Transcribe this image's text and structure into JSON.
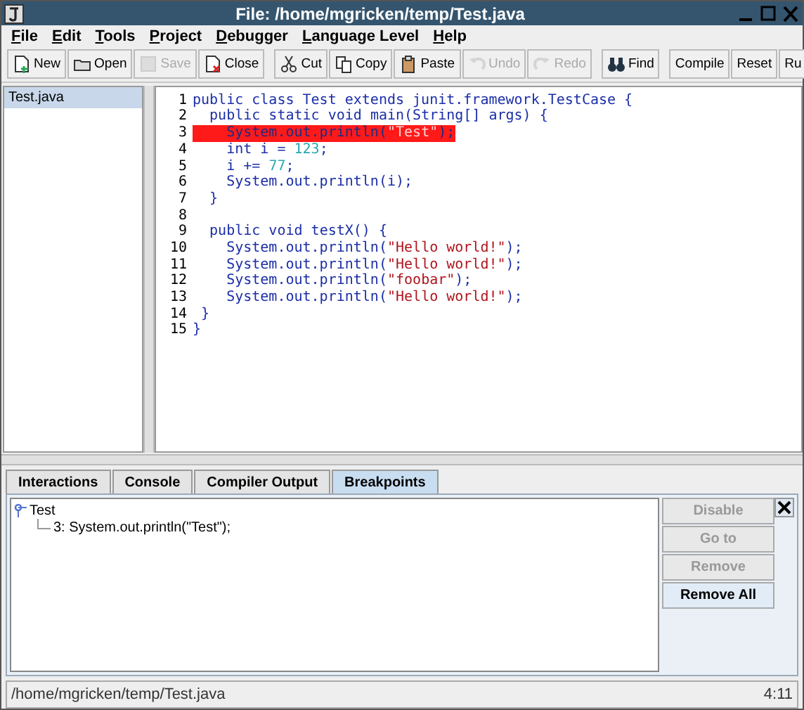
{
  "window": {
    "title": "File: /home/mgricken/temp/Test.java"
  },
  "menu": [
    "File",
    "Edit",
    "Tools",
    "Project",
    "Debugger",
    "Language Level",
    "Help"
  ],
  "toolbar": [
    {
      "label": "New",
      "disabled": false
    },
    {
      "label": "Open",
      "disabled": false
    },
    {
      "label": "Save",
      "disabled": true
    },
    {
      "label": "Close",
      "disabled": false
    },
    {
      "label": "Cut",
      "disabled": false
    },
    {
      "label": "Copy",
      "disabled": false
    },
    {
      "label": "Paste",
      "disabled": false
    },
    {
      "label": "Undo",
      "disabled": true
    },
    {
      "label": "Redo",
      "disabled": true
    },
    {
      "label": "Find",
      "disabled": false
    },
    {
      "label": "Compile",
      "disabled": false
    },
    {
      "label": "Reset",
      "disabled": false
    },
    {
      "label": "Ru",
      "disabled": false
    }
  ],
  "files": [
    {
      "name": "Test.java",
      "selected": true
    }
  ],
  "code": [
    {
      "number": "1",
      "breakpoint": false,
      "segments": [
        {
          "kind": "keyword",
          "text": "public class Test extends"
        },
        {
          "kind": "plain",
          "text": " junit.framework.TestCase {"
        }
      ]
    },
    {
      "number": "2",
      "breakpoint": false,
      "segments": [
        {
          "kind": "keyword",
          "text": "  public static void"
        },
        {
          "kind": "plain",
          "text": " main(String[] args) {"
        }
      ]
    },
    {
      "number": "3",
      "breakpoint": true,
      "segments": [
        {
          "kind": "plain",
          "text": "    System.out.println("
        },
        {
          "kind": "string",
          "text": "\"Test\""
        },
        {
          "kind": "plain",
          "text": ");"
        }
      ]
    },
    {
      "number": "4",
      "breakpoint": false,
      "segments": [
        {
          "kind": "keyword",
          "text": "    int"
        },
        {
          "kind": "plain",
          "text": " i = "
        },
        {
          "kind": "number",
          "text": "123"
        },
        {
          "kind": "plain",
          "text": ";"
        }
      ]
    },
    {
      "number": "5",
      "breakpoint": false,
      "segments": [
        {
          "kind": "plain",
          "text": "    i += "
        },
        {
          "kind": "number",
          "text": "77"
        },
        {
          "kind": "plain",
          "text": ";"
        }
      ]
    },
    {
      "number": "6",
      "breakpoint": false,
      "segments": [
        {
          "kind": "plain",
          "text": "    System.out.println(i);"
        }
      ]
    },
    {
      "number": "7",
      "breakpoint": false,
      "segments": [
        {
          "kind": "plain",
          "text": "  }"
        }
      ]
    },
    {
      "number": "8",
      "breakpoint": false
    },
    {
      "number": "9",
      "breakpoint": false,
      "segments": [
        {
          "kind": "keyword",
          "text": "  public void"
        },
        {
          "kind": "plain",
          "text": " testX() {"
        }
      ]
    },
    {
      "number": "10",
      "breakpoint": false,
      "segments": [
        {
          "kind": "plain",
          "text": "    System.out.println("
        },
        {
          "kind": "string",
          "text": "\"Hello world!\""
        },
        {
          "kind": "plain",
          "text": ");"
        }
      ]
    },
    {
      "number": "11",
      "breakpoint": false,
      "segments": [
        {
          "kind": "plain",
          "text": "    System.out.println("
        },
        {
          "kind": "string",
          "text": "\"Hello world!\""
        },
        {
          "kind": "plain",
          "text": ");"
        }
      ]
    },
    {
      "number": "12",
      "breakpoint": false,
      "segments": [
        {
          "kind": "plain",
          "text": "    System.out.println("
        },
        {
          "kind": "string",
          "text": "\"foobar\""
        },
        {
          "kind": "plain",
          "text": ");"
        }
      ]
    },
    {
      "number": "13",
      "breakpoint": false,
      "segments": [
        {
          "kind": "plain",
          "text": "    System.out.println("
        },
        {
          "kind": "string",
          "text": "\"Hello world!\""
        },
        {
          "kind": "plain",
          "text": ");"
        }
      ]
    },
    {
      "number": "14",
      "breakpoint": false,
      "segments": [
        {
          "kind": "plain",
          "text": " }"
        }
      ]
    },
    {
      "number": "15",
      "breakpoint": false,
      "segments": [
        {
          "kind": "plain",
          "text": "}"
        }
      ]
    }
  ],
  "tabs": [
    {
      "label": "Interactions",
      "selected": false
    },
    {
      "label": "Console",
      "selected": false
    },
    {
      "label": "Compiler Output",
      "selected": false
    },
    {
      "label": "Breakpoints",
      "selected": true
    }
  ],
  "breakpoints": [
    {
      "label": "Test",
      "children": [
        {
          "label": "3: System.out.println(\"Test\");"
        }
      ]
    }
  ],
  "breakpoint_buttons": [
    {
      "label": "Disable",
      "disabled": true
    },
    {
      "label": "Go to",
      "disabled": true
    },
    {
      "label": "Remove",
      "disabled": true
    },
    {
      "label": "Remove All",
      "disabled": false
    }
  ],
  "status_bar": {
    "path": "/home/mgricken/temp/Test.java",
    "position": "4:11"
  }
}
